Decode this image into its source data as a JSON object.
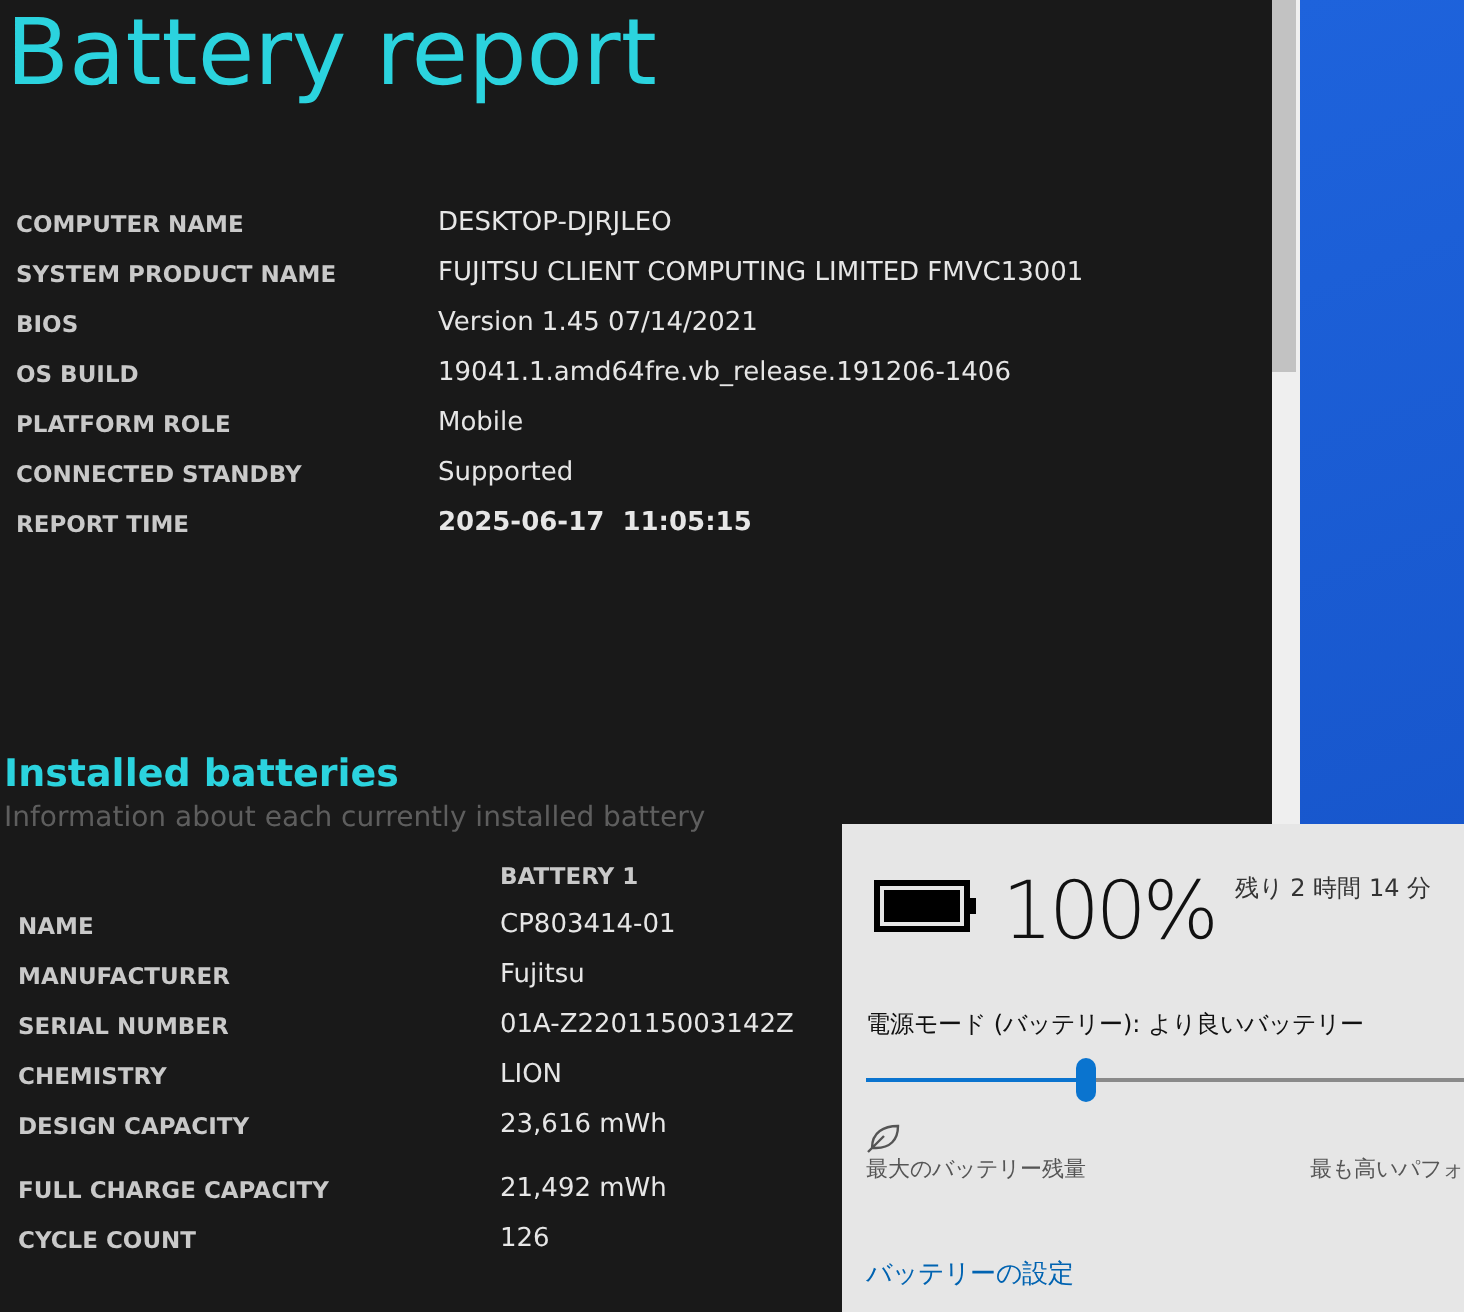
{
  "report": {
    "title": "Battery report",
    "system_info": [
      {
        "label": "COMPUTER NAME",
        "value": "DESKTOP-DJRJLEO",
        "bold": false
      },
      {
        "label": "SYSTEM PRODUCT NAME",
        "value": "FUJITSU CLIENT COMPUTING LIMITED FMVC13001",
        "bold": false
      },
      {
        "label": "BIOS",
        "value": "Version 1.45 07/14/2021",
        "bold": false
      },
      {
        "label": "OS BUILD",
        "value": "19041.1.amd64fre.vb_release.191206-1406",
        "bold": false
      },
      {
        "label": "PLATFORM ROLE",
        "value": "Mobile",
        "bold": false
      },
      {
        "label": "CONNECTED STANDBY",
        "value": "Supported",
        "bold": false
      },
      {
        "label": "REPORT TIME",
        "value": "2025-06-17  11:05:15",
        "bold": true
      }
    ],
    "installed_batteries": {
      "title": "Installed batteries",
      "subtitle": "Information about each currently installed battery",
      "column": "BATTERY 1",
      "rows": [
        {
          "label": "NAME",
          "value": "CP803414-01"
        },
        {
          "label": "MANUFACTURER",
          "value": "Fujitsu"
        },
        {
          "label": "SERIAL NUMBER",
          "value": "01A-Z220115003142Z"
        },
        {
          "label": "CHEMISTRY",
          "value": "LION"
        },
        {
          "label": "DESIGN CAPACITY",
          "value": "23,616 mWh"
        },
        {
          "label": "FULL CHARGE CAPACITY",
          "value": "21,492 mWh"
        },
        {
          "label": "CYCLE COUNT",
          "value": "126"
        }
      ]
    }
  },
  "battery_flyout": {
    "percent": "100%",
    "remaining": "残り 2 時間 14 分",
    "power_mode": "電源モード (バッテリー): より良いバッテリー",
    "slider": {
      "level": 0.25,
      "left_label": "最大のバッテリー残量",
      "right_label": "最も高いパフォ"
    },
    "settings_link": "バッテリーの設定"
  }
}
